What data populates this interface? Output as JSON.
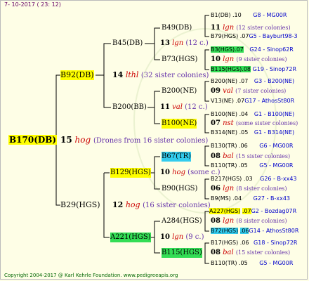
{
  "header": {
    "date": "7- 10-2017 ( 23: 12)"
  },
  "footer": {
    "copyright": "Copyright 2004-2017 @ Karl Kehrle Foundation.   www.pedigreeapis.org"
  },
  "root": {
    "name": "B170(DB)",
    "num": "15",
    "code": "hog",
    "sisters": "(Drones from 16 sister colonies)"
  },
  "g1": {
    "top": {
      "name": "B92(DB)",
      "num": "14",
      "code": "lthl",
      "sisters": "(32 sister colonies)"
    },
    "bottom": {
      "name": "B29(HGS)",
      "num": "12",
      "code": "hog",
      "sisters": "(16 sister colonies)"
    }
  },
  "g2": {
    "b45": {
      "name": "B45(DB)",
      "num": "13",
      "code": "lgn",
      "sisters": "(12 c.)"
    },
    "b200": {
      "name": "B200(BB)",
      "num": "11",
      "code": "val",
      "sisters": "(12 c.)"
    },
    "b129": {
      "name": "B129(HGS)",
      "num": "10",
      "code": "hog",
      "sisters": "(some c.)"
    },
    "a221": {
      "name": "A221(HGS)",
      "num": "10",
      "code": "lgn",
      "sisters": "(9 c.)"
    }
  },
  "g3": {
    "b49": {
      "name": "B49(DB)",
      "num": "11",
      "code": "lgn",
      "sisters": "(12 sister colonies)"
    },
    "b73": {
      "name": "B73(HGS)",
      "num": "10",
      "code": "lgn",
      "sisters": "(9 sister colonies)"
    },
    "b200ne": {
      "name": "B200(NE)",
      "num": "09",
      "code": "val",
      "sisters": "(7 sister colonies)"
    },
    "b100": {
      "name": "B100(NE)",
      "num": "07",
      "code": "nst",
      "sisters": "(some sister colonies)"
    },
    "b67": {
      "name": "B67(TR)",
      "num": "08",
      "code": "bal",
      "sisters": "(15 sister colonies)"
    },
    "b90": {
      "name": "B90(HGS)",
      "num": "06",
      "code": "lgn",
      "sisters": "(8 sister colonies)"
    },
    "a284": {
      "name": "A284(HGS)",
      "num": "08",
      "code": "lgn",
      "sisters": "(8 sister colonies)"
    },
    "b115": {
      "name": "B115(HGS)",
      "num": "08",
      "code": "bal",
      "sisters": "(15 sister colonies)"
    }
  },
  "g4": [
    {
      "name": "B1(DB)",
      "val": ".10",
      "place": "G8 - MG00R"
    },
    {
      "name": "B79(HGS)",
      "val": ".07",
      "place": "G5 - Bayburt98-3"
    },
    {
      "name": "B3(HGS)",
      "val": ".07",
      "place": "G24 - Sinop62R"
    },
    {
      "name": "B115(HGS)",
      "val": ".08",
      "place": "G19 - Sinop72R"
    },
    {
      "name": "B200(NE)",
      "val": ".07",
      "place": "G3 - B200(NE)"
    },
    {
      "name": "V13(NE)",
      "val": ".07",
      "place": "G17 - AthosSt80R"
    },
    {
      "name": "B100(NE)",
      "val": ".04",
      "place": "G1 - B100(NE)"
    },
    {
      "name": "B314(NE)",
      "val": ".05",
      "place": "G1 - B314(NE)"
    },
    {
      "name": "B130(TR)",
      "val": ".06",
      "place": "G6 - MG00R"
    },
    {
      "name": "B110(TR)",
      "val": ".05",
      "place": "G5 - MG00R"
    },
    {
      "name": "B217(HGS)",
      "val": ".03",
      "place": "G26 - B-xx43"
    },
    {
      "name": "B9(MS)",
      "val": ".04",
      "place": "G27 - B-xx43"
    },
    {
      "name": "A227(HGS)",
      "val": ".07",
      "place": "G2 - Bozdag07R"
    },
    {
      "name": "B72(HGS)",
      "val": ".06",
      "place": "G14 - AthosSt80R"
    },
    {
      "name": "B17(HGS)",
      "val": ".06",
      "place": "G18 - Sinop72R"
    },
    {
      "name": "B110(TR)",
      "val": ".05",
      "place": "G5 - MG00R"
    }
  ]
}
